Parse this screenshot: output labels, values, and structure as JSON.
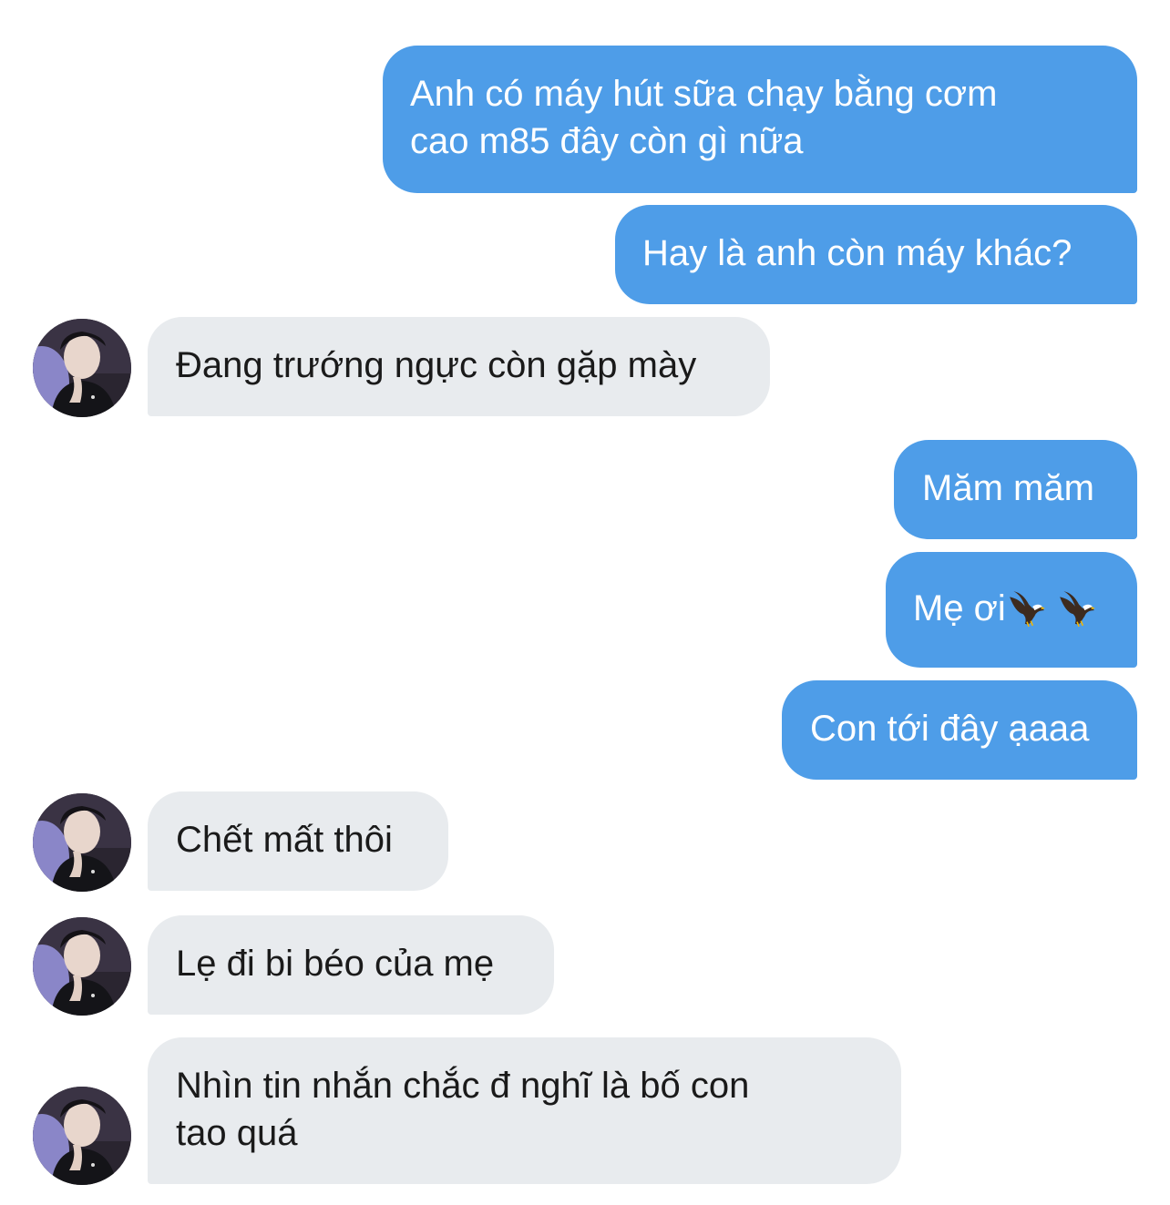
{
  "messages": [
    {
      "side": "sent",
      "lines": [
        "Anh có máy hút sữa chạy bằng cơm",
        "cao m85 đây còn gì nữa"
      ]
    },
    {
      "side": "sent",
      "lines": [
        "Hay là anh còn máy khác?"
      ]
    },
    {
      "side": "received",
      "lines": [
        "Đang trướng ngực còn gặp mày"
      ]
    },
    {
      "side": "sent",
      "lines": [
        "Măm măm"
      ]
    },
    {
      "side": "sent",
      "lines": [
        "Mẹ ơi"
      ],
      "emoji": [
        "eagle-icon",
        "eagle-icon"
      ]
    },
    {
      "side": "sent",
      "lines": [
        "Con tới đây ạaaa"
      ]
    },
    {
      "side": "received",
      "lines": [
        "Chết mất thôi"
      ]
    },
    {
      "side": "received",
      "lines": [
        "Lẹ đi bi béo của mẹ"
      ]
    },
    {
      "side": "received",
      "lines": [
        "Nhìn tin nhắn chắc đ nghĩ là bố con",
        "tao quá"
      ]
    }
  ],
  "colors": {
    "sent_bubble": "#4e9de8",
    "received_bubble": "#e8ebee",
    "sent_text": "#ffffff",
    "received_text": "#1a1a1a"
  }
}
